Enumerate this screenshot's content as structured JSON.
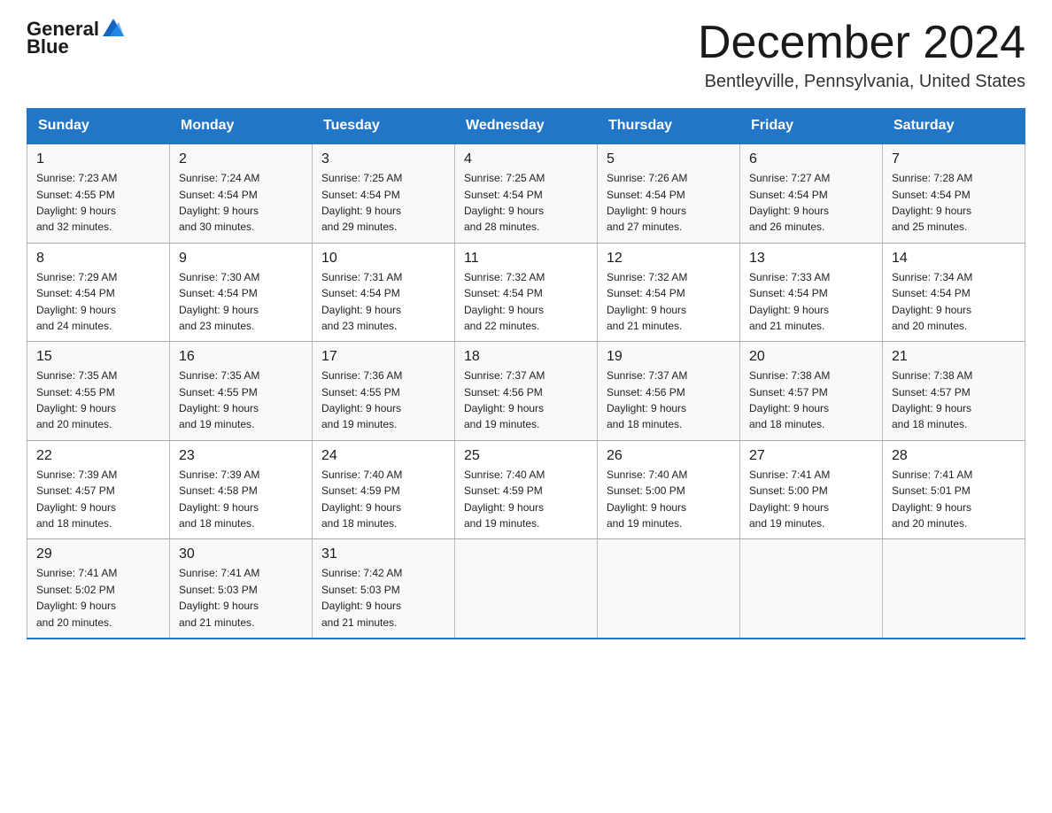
{
  "header": {
    "logo_text_general": "General",
    "logo_text_blue": "Blue",
    "month_year": "December 2024",
    "location": "Bentleyville, Pennsylvania, United States"
  },
  "days_of_week": [
    "Sunday",
    "Monday",
    "Tuesday",
    "Wednesday",
    "Thursday",
    "Friday",
    "Saturday"
  ],
  "weeks": [
    [
      {
        "day": "1",
        "sunrise": "7:23 AM",
        "sunset": "4:55 PM",
        "daylight": "9 hours and 32 minutes."
      },
      {
        "day": "2",
        "sunrise": "7:24 AM",
        "sunset": "4:54 PM",
        "daylight": "9 hours and 30 minutes."
      },
      {
        "day": "3",
        "sunrise": "7:25 AM",
        "sunset": "4:54 PM",
        "daylight": "9 hours and 29 minutes."
      },
      {
        "day": "4",
        "sunrise": "7:25 AM",
        "sunset": "4:54 PM",
        "daylight": "9 hours and 28 minutes."
      },
      {
        "day": "5",
        "sunrise": "7:26 AM",
        "sunset": "4:54 PM",
        "daylight": "9 hours and 27 minutes."
      },
      {
        "day": "6",
        "sunrise": "7:27 AM",
        "sunset": "4:54 PM",
        "daylight": "9 hours and 26 minutes."
      },
      {
        "day": "7",
        "sunrise": "7:28 AM",
        "sunset": "4:54 PM",
        "daylight": "9 hours and 25 minutes."
      }
    ],
    [
      {
        "day": "8",
        "sunrise": "7:29 AM",
        "sunset": "4:54 PM",
        "daylight": "9 hours and 24 minutes."
      },
      {
        "day": "9",
        "sunrise": "7:30 AM",
        "sunset": "4:54 PM",
        "daylight": "9 hours and 23 minutes."
      },
      {
        "day": "10",
        "sunrise": "7:31 AM",
        "sunset": "4:54 PM",
        "daylight": "9 hours and 23 minutes."
      },
      {
        "day": "11",
        "sunrise": "7:32 AM",
        "sunset": "4:54 PM",
        "daylight": "9 hours and 22 minutes."
      },
      {
        "day": "12",
        "sunrise": "7:32 AM",
        "sunset": "4:54 PM",
        "daylight": "9 hours and 21 minutes."
      },
      {
        "day": "13",
        "sunrise": "7:33 AM",
        "sunset": "4:54 PM",
        "daylight": "9 hours and 21 minutes."
      },
      {
        "day": "14",
        "sunrise": "7:34 AM",
        "sunset": "4:54 PM",
        "daylight": "9 hours and 20 minutes."
      }
    ],
    [
      {
        "day": "15",
        "sunrise": "7:35 AM",
        "sunset": "4:55 PM",
        "daylight": "9 hours and 20 minutes."
      },
      {
        "day": "16",
        "sunrise": "7:35 AM",
        "sunset": "4:55 PM",
        "daylight": "9 hours and 19 minutes."
      },
      {
        "day": "17",
        "sunrise": "7:36 AM",
        "sunset": "4:55 PM",
        "daylight": "9 hours and 19 minutes."
      },
      {
        "day": "18",
        "sunrise": "7:37 AM",
        "sunset": "4:56 PM",
        "daylight": "9 hours and 19 minutes."
      },
      {
        "day": "19",
        "sunrise": "7:37 AM",
        "sunset": "4:56 PM",
        "daylight": "9 hours and 18 minutes."
      },
      {
        "day": "20",
        "sunrise": "7:38 AM",
        "sunset": "4:57 PM",
        "daylight": "9 hours and 18 minutes."
      },
      {
        "day": "21",
        "sunrise": "7:38 AM",
        "sunset": "4:57 PM",
        "daylight": "9 hours and 18 minutes."
      }
    ],
    [
      {
        "day": "22",
        "sunrise": "7:39 AM",
        "sunset": "4:57 PM",
        "daylight": "9 hours and 18 minutes."
      },
      {
        "day": "23",
        "sunrise": "7:39 AM",
        "sunset": "4:58 PM",
        "daylight": "9 hours and 18 minutes."
      },
      {
        "day": "24",
        "sunrise": "7:40 AM",
        "sunset": "4:59 PM",
        "daylight": "9 hours and 18 minutes."
      },
      {
        "day": "25",
        "sunrise": "7:40 AM",
        "sunset": "4:59 PM",
        "daylight": "9 hours and 19 minutes."
      },
      {
        "day": "26",
        "sunrise": "7:40 AM",
        "sunset": "5:00 PM",
        "daylight": "9 hours and 19 minutes."
      },
      {
        "day": "27",
        "sunrise": "7:41 AM",
        "sunset": "5:00 PM",
        "daylight": "9 hours and 19 minutes."
      },
      {
        "day": "28",
        "sunrise": "7:41 AM",
        "sunset": "5:01 PM",
        "daylight": "9 hours and 20 minutes."
      }
    ],
    [
      {
        "day": "29",
        "sunrise": "7:41 AM",
        "sunset": "5:02 PM",
        "daylight": "9 hours and 20 minutes."
      },
      {
        "day": "30",
        "sunrise": "7:41 AM",
        "sunset": "5:03 PM",
        "daylight": "9 hours and 21 minutes."
      },
      {
        "day": "31",
        "sunrise": "7:42 AM",
        "sunset": "5:03 PM",
        "daylight": "9 hours and 21 minutes."
      },
      null,
      null,
      null,
      null
    ]
  ],
  "labels": {
    "sunrise": "Sunrise:",
    "sunset": "Sunset:",
    "daylight": "Daylight:"
  }
}
